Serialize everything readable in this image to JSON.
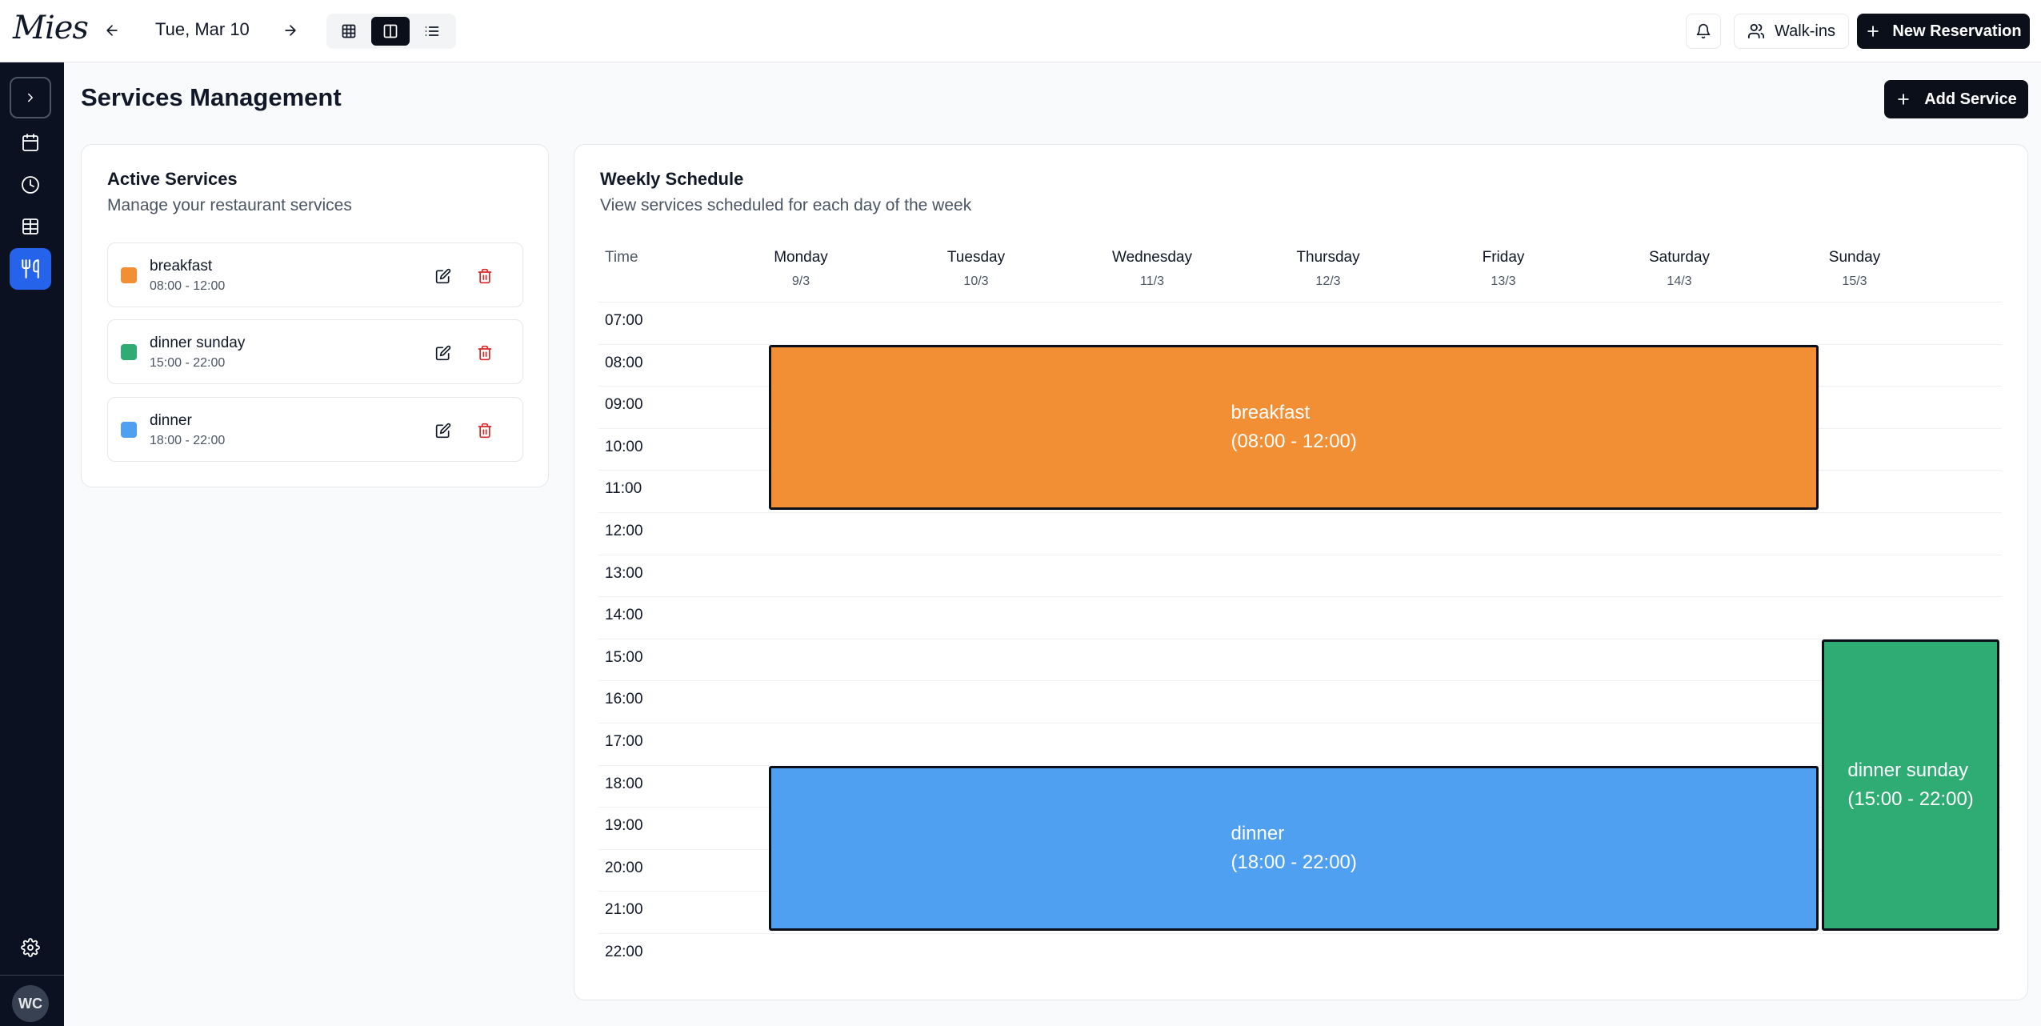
{
  "app": {
    "logo": "Mies"
  },
  "header": {
    "date": "Tue, Mar 10",
    "walkins_label": "Walk-ins",
    "new_reservation_label": "New Reservation"
  },
  "sidebar": {
    "items": [
      "expand-icon",
      "calendar-icon",
      "clock-icon",
      "table-grid-icon",
      "utensils-icon"
    ],
    "avatar_initials": "WC"
  },
  "page": {
    "title": "Services Management",
    "add_service_label": "Add Service"
  },
  "active_services": {
    "title": "Active Services",
    "subtitle": "Manage your restaurant services",
    "items": [
      {
        "name": "breakfast",
        "time": "08:00 - 12:00",
        "color": "#f28f34"
      },
      {
        "name": "dinner sunday",
        "time": "15:00 - 22:00",
        "color": "#2fac74"
      },
      {
        "name": "dinner",
        "time": "18:00 - 22:00",
        "color": "#4fa0f0"
      }
    ]
  },
  "schedule": {
    "title": "Weekly Schedule",
    "subtitle": "View services scheduled for each day of the week",
    "time_header": "Time",
    "days": [
      {
        "name": "Monday",
        "date": "9/3"
      },
      {
        "name": "Tuesday",
        "date": "10/3"
      },
      {
        "name": "Wednesday",
        "date": "11/3"
      },
      {
        "name": "Thursday",
        "date": "12/3"
      },
      {
        "name": "Friday",
        "date": "13/3"
      },
      {
        "name": "Saturday",
        "date": "14/3"
      },
      {
        "name": "Sunday",
        "date": "15/3"
      }
    ],
    "times": [
      "07:00",
      "08:00",
      "09:00",
      "10:00",
      "11:00",
      "12:00",
      "13:00",
      "14:00",
      "15:00",
      "16:00",
      "17:00",
      "18:00",
      "19:00",
      "20:00",
      "21:00",
      "22:00"
    ],
    "blocks": [
      {
        "name": "breakfast",
        "range": "(08:00 - 12:00)",
        "color": "#f28f34",
        "day_start": 0,
        "day_end": 5,
        "start": 8,
        "end": 12
      },
      {
        "name": "dinner sunday",
        "range": "(15:00 - 22:00)",
        "color": "#2fac74",
        "day_start": 6,
        "day_end": 6,
        "start": 15,
        "end": 22
      },
      {
        "name": "dinner",
        "range": "(18:00 - 22:00)",
        "color": "#4fa0f0",
        "day_start": 0,
        "day_end": 5,
        "start": 18,
        "end": 22
      }
    ]
  }
}
